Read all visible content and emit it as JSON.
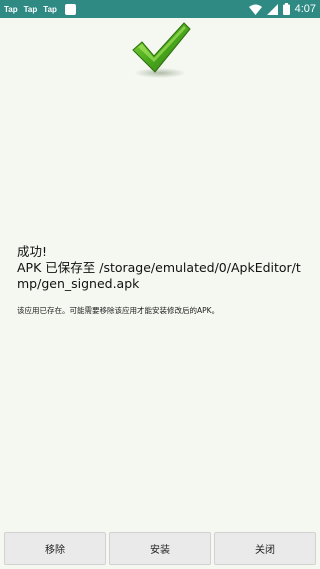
{
  "status_bar": {
    "apps": [
      "Tap",
      "Tap",
      "Tap"
    ],
    "time": "4:07",
    "icons": [
      "wifi-icon",
      "signal-icon",
      "battery-icon"
    ],
    "color": "#2f8a84"
  },
  "content": {
    "check_icon": "checkmark-icon",
    "check_color": "#4caa1e",
    "title": "成功!",
    "path": "APK 已保存至 /storage/emulated/0/ApkEditor/tmp/gen_signed.apk",
    "note": "该应用已存在。可能需要移除该应用才能安装修改后的APK。"
  },
  "buttons": {
    "remove": "移除",
    "install": "安装",
    "close": "关闭"
  }
}
